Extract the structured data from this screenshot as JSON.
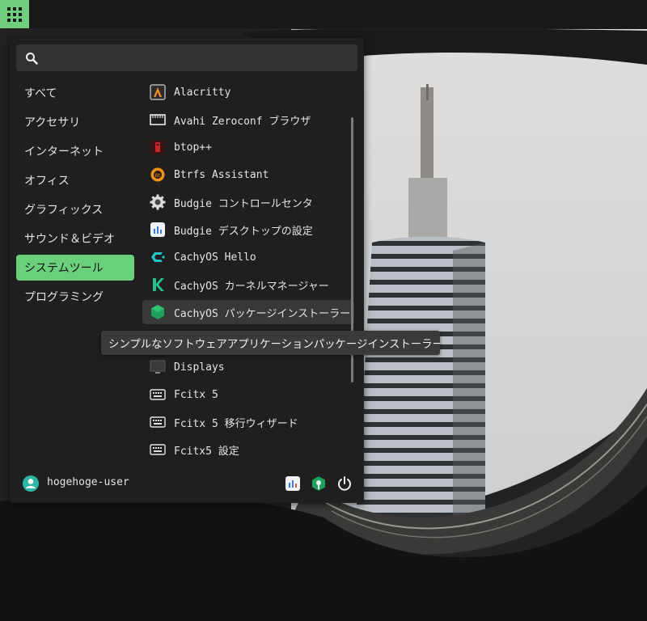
{
  "panel": {
    "menu_button_icon": "grid-icon"
  },
  "search": {
    "icon": "search-icon",
    "placeholder": "",
    "value": ""
  },
  "categories": [
    {
      "label": "すべて",
      "active": false
    },
    {
      "label": "アクセサリ",
      "active": false
    },
    {
      "label": "インターネット",
      "active": false
    },
    {
      "label": "オフィス",
      "active": false
    },
    {
      "label": "グラフィックス",
      "active": false
    },
    {
      "label": "サウンド＆ビデオ",
      "active": false
    },
    {
      "label": "システムツール",
      "active": true
    },
    {
      "label": "プログラミング",
      "active": false
    }
  ],
  "apps": [
    {
      "label": "Alacritty",
      "icon": "alacritty-icon"
    },
    {
      "label": "Avahi Zeroconf ブラウザ",
      "icon": "network-icon"
    },
    {
      "label": "btop++",
      "icon": "btop-icon"
    },
    {
      "label": "Btrfs Assistant",
      "icon": "btrfs-icon"
    },
    {
      "label": "Budgie コントロールセンタ",
      "icon": "gear-icon"
    },
    {
      "label": "Budgie デスクトップの設定",
      "icon": "desktop-settings-icon"
    },
    {
      "label": "CachyOS Hello",
      "icon": "cachyos-icon"
    },
    {
      "label": "CachyOS カーネルマネージャー",
      "icon": "kernel-manager-icon"
    },
    {
      "label": "CachyOS パッケージインストーラー",
      "icon": "package-installer-icon",
      "hover": true
    },
    {
      "label": "",
      "icon": "hidden-app-icon"
    },
    {
      "label": "Displays",
      "icon": "monitor-icon"
    },
    {
      "label": "Fcitx 5",
      "icon": "keyboard-icon"
    },
    {
      "label": "Fcitx 5 移行ウィザード",
      "icon": "keyboard-icon"
    },
    {
      "label": "Fcitx5 設定",
      "icon": "keyboard-icon"
    }
  ],
  "tooltip": {
    "text": "シンプルなソフトウェアアプリケーションパッケージインストーラー"
  },
  "user": {
    "name": "hogehoge-user",
    "icon": "user-avatar-icon"
  },
  "footer_buttons": [
    {
      "name": "settings-button",
      "icon": "desktop-settings-icon"
    },
    {
      "name": "software-button",
      "icon": "package-installer-icon"
    },
    {
      "name": "power-button",
      "icon": "power-icon"
    }
  ],
  "colors": {
    "accent": "#6ad07c",
    "menu_bg": "#1f1f1f",
    "panel_bg": "#181818"
  }
}
